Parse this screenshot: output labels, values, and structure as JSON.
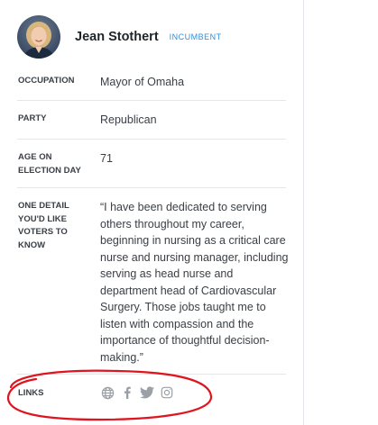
{
  "candidate": {
    "name": "Jean Stothert",
    "status_badge": "INCUMBENT"
  },
  "fields": {
    "occupation": {
      "label": "OCCUPATION",
      "value": "Mayor of Omaha"
    },
    "party": {
      "label": "PARTY",
      "value": "Republican"
    },
    "age": {
      "label": "AGE ON ELECTION DAY",
      "value": "71"
    },
    "detail": {
      "label": "ONE DETAIL YOU'D LIKE VOTERS TO KNOW",
      "value": "“I have been dedicated to serving others throughout my career, beginning in nursing as a critical care nurse and nursing manager, including serving as head nurse and department head of Cardiovascular Surgery. Those jobs taught me to listen with compassion and the importance of thoughtful decision-making.”"
    },
    "links": {
      "label": "LINKS",
      "icons": [
        "globe-icon",
        "facebook-icon",
        "twitter-icon",
        "instagram-icon"
      ]
    }
  },
  "colors": {
    "badge": "#2e8fd6",
    "text": "#3a3f45",
    "icon": "#9aa0a6",
    "annotation": "#e0141e"
  }
}
